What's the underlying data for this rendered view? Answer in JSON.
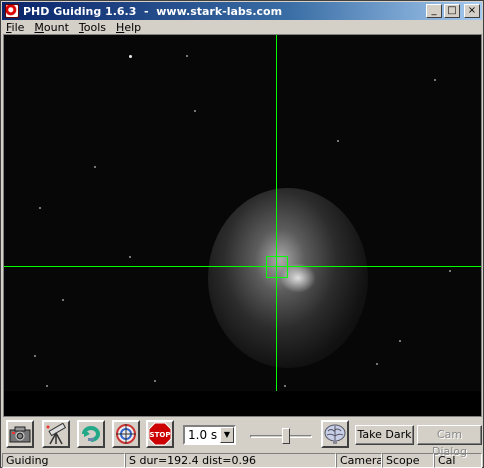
{
  "window": {
    "title": "PHD Guiding 1.6.3  -  www.stark-labs.com",
    "controls": {
      "minimize": "_",
      "maximize": "□",
      "close": "×"
    }
  },
  "menu": [
    {
      "label": "File",
      "accel": "F",
      "rest": "ile"
    },
    {
      "label": "Mount",
      "accel": "M",
      "rest": "ount"
    },
    {
      "label": "Tools",
      "accel": "T",
      "rest": "ools"
    },
    {
      "label": "Help",
      "accel": "H",
      "rest": "elp"
    }
  ],
  "toolbar": {
    "icons": [
      "camera-connect-icon",
      "telescope-connect-icon",
      "loop-icon",
      "guide-target-icon",
      "stop-icon"
    ],
    "stop_label": "STOP",
    "exposure": "1.0 s",
    "gamma_level": 0.6,
    "take_dark": "Take Dark",
    "cam_dialog": "Cam Dialog",
    "brain_icon": "brain-icon"
  },
  "status": {
    "message": "Guiding",
    "info": "S dur=192.4 dist=0.96",
    "camera": "Camera",
    "scope": "Scope",
    "cal": "Cal"
  },
  "colors": {
    "crosshair": "#00ff00",
    "title_start": "#0a246a",
    "stop_red": "#cc0000"
  }
}
